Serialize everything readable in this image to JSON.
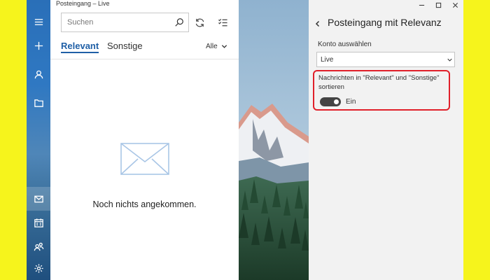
{
  "window": {
    "title": "Posteingang – Live"
  },
  "search": {
    "placeholder": "Suchen"
  },
  "tabs": [
    {
      "label": "Relevant",
      "active": true
    },
    {
      "label": "Sonstige",
      "active": false
    }
  ],
  "filter": {
    "label": "Alle"
  },
  "empty_state": {
    "message": "Noch nichts angekommen."
  },
  "settings": {
    "title": "Posteingang mit Relevanz",
    "account_label": "Konto auswählen",
    "account_value": "Live",
    "sort_description": "Nachrichten in \"Relevant\" und \"Sonstige\" sortieren",
    "toggle_state": "Ein",
    "toggle_on": true
  },
  "nav_icons": [
    "hamburger-icon",
    "compose-icon",
    "accounts-icon",
    "folders-icon",
    "mail-icon",
    "calendar-icon",
    "people-icon",
    "settings-icon"
  ],
  "colors": {
    "accent": "#1f5fa6",
    "highlight": "#e0202a",
    "background": "#f6f41c"
  }
}
